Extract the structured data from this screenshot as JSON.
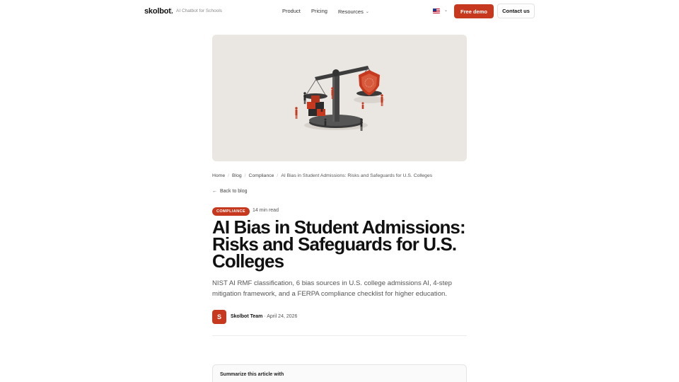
{
  "nav": {
    "logo": "skolbot.",
    "tagline": "AI Chatbot for Schools",
    "links": [
      {
        "label": "Product"
      },
      {
        "label": "Pricing"
      },
      {
        "label": "Resources"
      }
    ],
    "cta_primary": "Free demo",
    "cta_secondary": "Contact us"
  },
  "breadcrumb": [
    "Home",
    "Blog",
    "Compliance",
    "AI Bias in Student Admissions: Risks and Safeguards for U.S. Colleges"
  ],
  "back_link": "Back to blog",
  "article": {
    "category": "COMPLIANCE",
    "read_time": "14 min read",
    "title": "AI Bias in Student Admissions: Risks and Safeguards for U.S. Colleges",
    "subtitle": "NIST AI RMF classification, 6 bias sources in U.S. college admissions AI, 4-step mitigation framework, and a FERPA compliance checklist for higher education.",
    "author_initial": "S",
    "author": "Skolbot Team",
    "date": "· April 24, 2026"
  },
  "summary": {
    "label": "Summarize this article with"
  },
  "colors": {
    "accent": "#c7391f",
    "hero_bg": "#eae6e2"
  }
}
